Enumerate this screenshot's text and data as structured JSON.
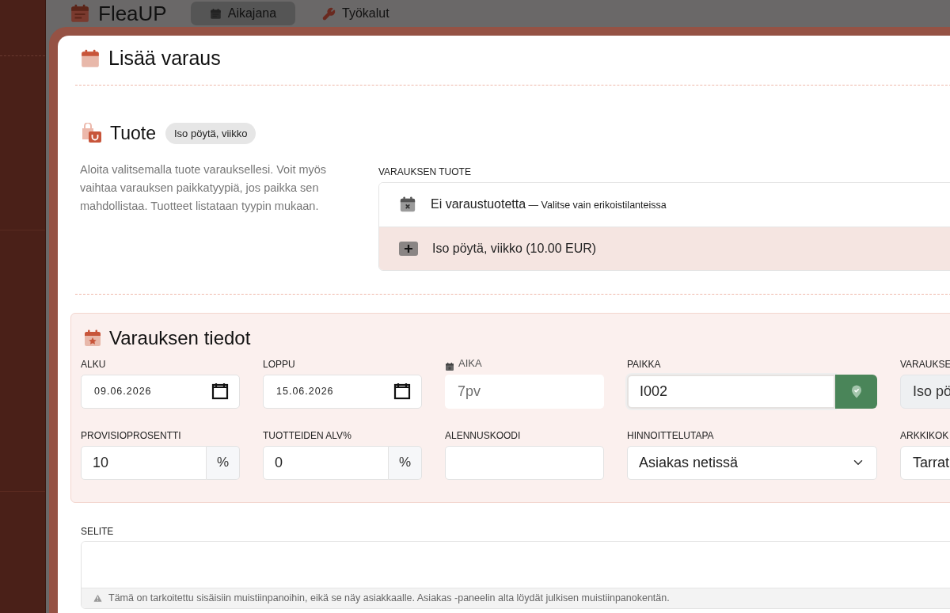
{
  "app_header": {
    "logo": "FleaUP",
    "tabs": [
      {
        "label": "Aikajana",
        "selected": true
      },
      {
        "label": "Työkalut",
        "selected": false
      }
    ]
  },
  "dialog": {
    "title": "Lisää varaus",
    "product_section": {
      "title": "Tuote",
      "badge": "Iso pöytä, viikko",
      "description": "Aloita valitsemalla tuote varauksellesi. Voit myös vaihtaa varauksen paikkatyypiä, jos paikka sen mahdollistaa. Tuotteet listataan tyypin mukaan.",
      "field_label": "VARAUKSEN TUOTE",
      "options": [
        {
          "kind": "none",
          "label": "Ei varaustuotetta",
          "note": "— Valitse vain erikoistilanteissa",
          "selected": false
        },
        {
          "kind": "add",
          "label": "Iso pöytä, viikko (10.00 EUR)",
          "selected": true
        }
      ]
    },
    "details": {
      "title": "Varauksen tiedot",
      "fields": [
        {
          "kind": "date",
          "label": "ALKU",
          "value": "09.06.2026"
        },
        {
          "kind": "date",
          "label": "LOPPU",
          "value": "15.06.2026"
        },
        {
          "kind": "readonly",
          "label": "AIKA",
          "value": "7pv"
        },
        {
          "kind": "place",
          "label": "PAIKKA",
          "value": "I002"
        },
        {
          "kind": "disabled",
          "label": "VARAUKSE",
          "value": "Iso pö"
        },
        {
          "kind": "percent",
          "label": "PROVISIOPROSENTTI",
          "value": "10",
          "suffix": "%"
        },
        {
          "kind": "percent",
          "label": "TUOTTEIDEN ALV%",
          "value": "0",
          "suffix": "%"
        },
        {
          "kind": "text",
          "label": "ALENNUSKOODI"
        },
        {
          "kind": "select",
          "label": "HINNOITTELUTAPA",
          "value": "Asiakas netissä"
        },
        {
          "kind": "cut",
          "label": "ARKKIKOK",
          "value": "Tarrat"
        }
      ]
    },
    "notes": {
      "label": "SELITE",
      "hint": "Tämä on tarkoitettu sisäisiin muistiinpanoihin, eikä se näy asiakkaalle. Asiakas -paneelin alta löydät julkisen muistiinpanokentän."
    }
  }
}
